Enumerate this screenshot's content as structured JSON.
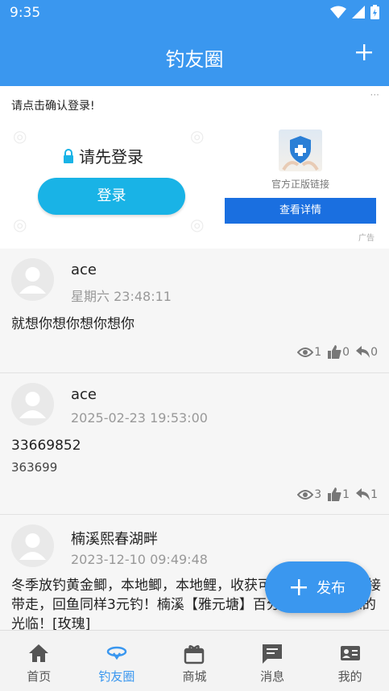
{
  "status_bar": {
    "time": "9:35"
  },
  "header": {
    "title": "钓友圈"
  },
  "ad": {
    "prompt": "请点击确认登录!",
    "more": "···",
    "login_title": "请先登录",
    "login_button": "登录",
    "official_link": "官方正版链接",
    "detail_button": "查看详情",
    "ad_label": "广告"
  },
  "posts": [
    {
      "author": "ace",
      "time": "星期六 23:48:11",
      "content": "就想你想你想你想你",
      "views": "1",
      "likes": "0",
      "replies": "0"
    },
    {
      "author": "ace",
      "time": "2025-02-23 19:53:00",
      "content": "33669852",
      "sub": "363699",
      "views": "3",
      "likes": "1",
      "replies": "1"
    },
    {
      "author": "楠溪熙春湖畔",
      "time": "2023-12-10 09:49:48",
      "content": "冬季放钓黄金鲫，本地鲫，本地鲤，收获可回可带，可以直接带走，回鱼同样3元钓！楠溪【雅元塘】百分百热情期待您的光临！[玫瑰]"
    }
  ],
  "fab": {
    "label": "发布"
  },
  "nav": [
    {
      "label": "首页",
      "icon": "home-icon"
    },
    {
      "label": "钓友圈",
      "icon": "fishing-circle-icon"
    },
    {
      "label": "商城",
      "icon": "shop-icon"
    },
    {
      "label": "消息",
      "icon": "message-icon"
    },
    {
      "label": "我的",
      "icon": "profile-card-icon"
    }
  ],
  "colors": {
    "primary": "#3a97ef",
    "login_button": "#19b3e6",
    "detail_button": "#1a6fe0"
  }
}
